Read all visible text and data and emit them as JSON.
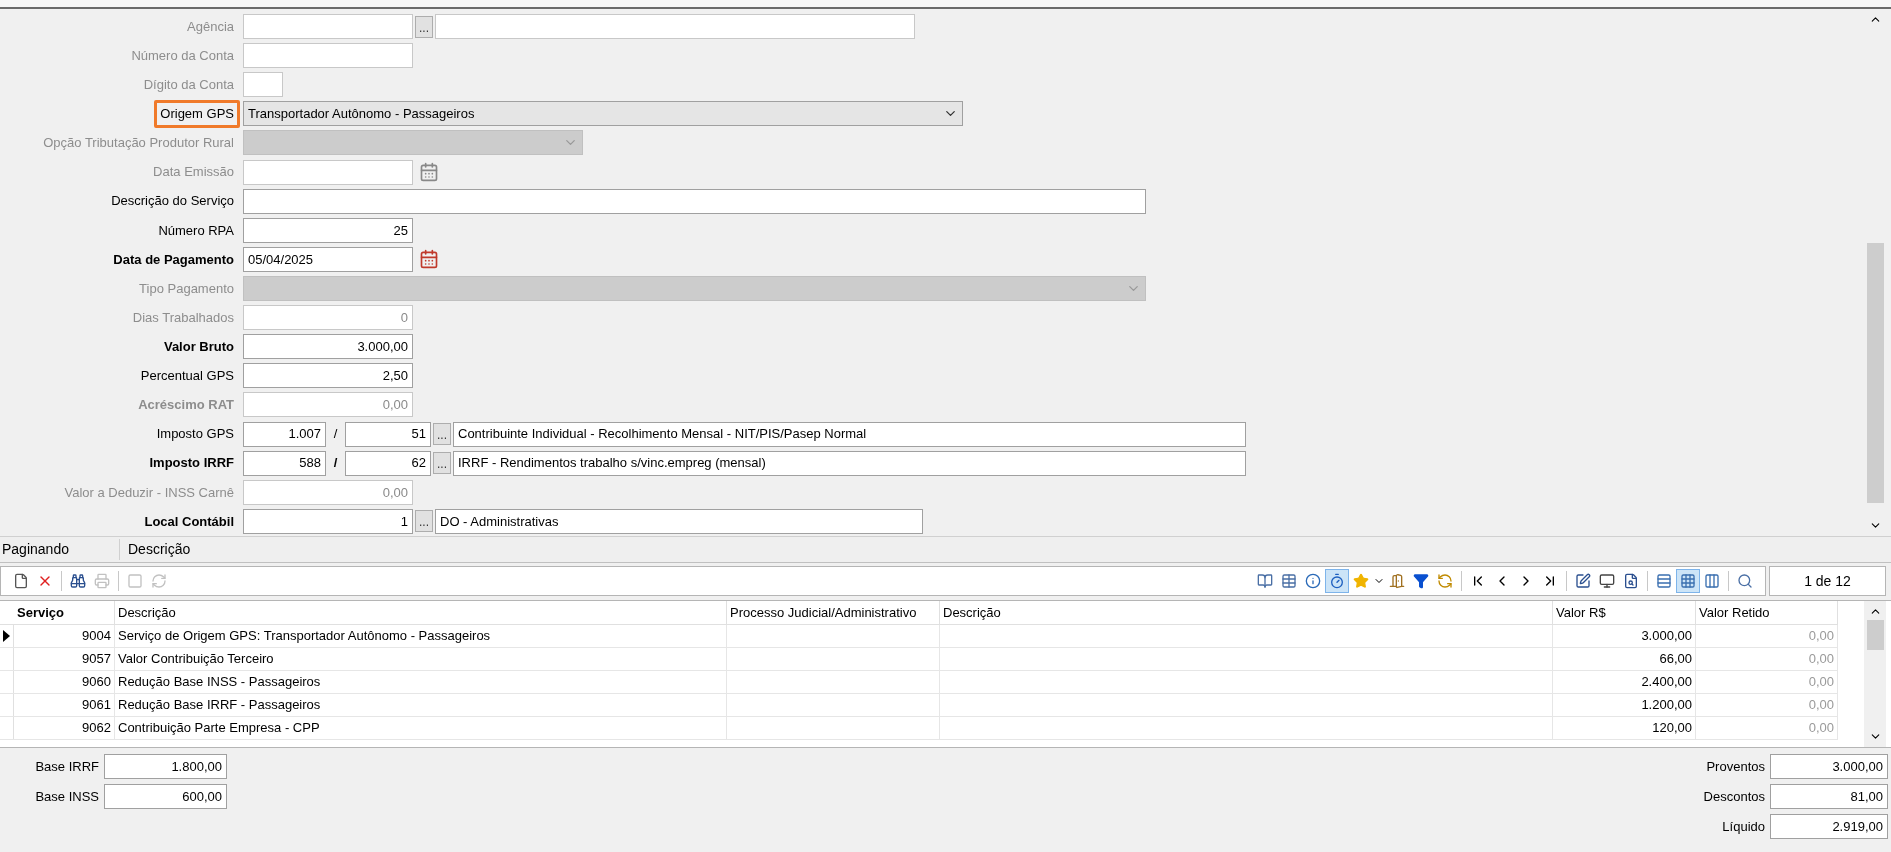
{
  "form": {
    "rows": [
      {
        "label": "Agência",
        "bold": false,
        "disabled": true,
        "highlighted": false,
        "kind": "lookup",
        "button": "..."
      },
      {
        "label": "Número da Conta",
        "bold": false,
        "disabled": true,
        "highlighted": false,
        "kind": "text"
      },
      {
        "label": "Dígito da Conta",
        "bold": false,
        "disabled": true,
        "highlighted": false,
        "kind": "text"
      },
      {
        "label": "Origem GPS",
        "bold": false,
        "disabled": false,
        "highlighted": true,
        "kind": "select",
        "value": "Transportador Autônomo - Passageiros"
      },
      {
        "label": "Opção Tributação Produtor Rural",
        "bold": false,
        "disabled": true,
        "highlighted": false,
        "kind": "select"
      },
      {
        "label": "Data Emissão",
        "bold": false,
        "disabled": true,
        "highlighted": false,
        "kind": "date"
      },
      {
        "label": "Descrição do Serviço",
        "bold": false,
        "disabled": false,
        "highlighted": false,
        "kind": "text"
      },
      {
        "label": "Número RPA",
        "bold": false,
        "disabled": false,
        "highlighted": false,
        "kind": "number",
        "value": "25"
      },
      {
        "label": "Data de Pagamento",
        "bold": true,
        "disabled": false,
        "highlighted": false,
        "kind": "date",
        "value": "05/04/2025"
      },
      {
        "label": "Tipo Pagamento",
        "bold": false,
        "disabled": true,
        "highlighted": false,
        "kind": "select"
      },
      {
        "label": "Dias Trabalhados",
        "bold": false,
        "disabled": true,
        "highlighted": false,
        "kind": "number",
        "value": "0"
      },
      {
        "label": "Valor Bruto",
        "bold": true,
        "disabled": false,
        "highlighted": false,
        "kind": "number",
        "value": "3.000,00"
      },
      {
        "label": "Percentual GPS",
        "bold": false,
        "disabled": false,
        "highlighted": false,
        "kind": "number",
        "value": "2,50"
      },
      {
        "label": "Acréscimo RAT",
        "bold": true,
        "disabled": true,
        "highlighted": false,
        "kind": "number",
        "value": "0,00"
      },
      {
        "label": "Imposto GPS",
        "bold": false,
        "disabled": false,
        "highlighted": false,
        "kind": "pair",
        "values": [
          "1.007",
          "51",
          "Contribuinte Individual - Recolhimento Mensal - NIT/PIS/Pasep Normal"
        ],
        "separator": "/",
        "button": "..."
      },
      {
        "label": "Imposto IRRF",
        "bold": true,
        "disabled": false,
        "highlighted": false,
        "kind": "pair",
        "values": [
          "588",
          "62",
          "IRRF - Rendimentos trabalho s/vinc.empreg (mensal)"
        ],
        "separator": "/",
        "button": "..."
      },
      {
        "label": "Valor a Deduzir - INSS Carnê",
        "bold": false,
        "disabled": true,
        "highlighted": false,
        "kind": "number",
        "value": "0,00"
      },
      {
        "label": "Local Contábil",
        "bold": true,
        "disabled": false,
        "highlighted": false,
        "kind": "code",
        "values": [
          "1",
          "DO - Administrativas"
        ],
        "button": "..."
      }
    ]
  },
  "group_header": [
    "Paginando",
    "Descrição"
  ],
  "toolbar": {
    "buttons": [
      {
        "pressed": false,
        "disabled": false
      },
      {
        "pressed": false,
        "disabled": false
      },
      {
        "pressed": false,
        "disabled": false
      },
      {
        "pressed": false,
        "disabled": true
      },
      {
        "pressed": false,
        "disabled": true
      },
      {
        "pressed": false,
        "disabled": true
      },
      {
        "pressed": false,
        "disabled": false
      },
      {
        "pressed": false,
        "disabled": false
      },
      {
        "pressed": false,
        "disabled": false
      },
      {
        "pressed": true,
        "disabled": false
      },
      {
        "pressed": false,
        "disabled": false
      },
      {
        "pressed": false,
        "disabled": false
      },
      {
        "pressed": false,
        "disabled": false
      },
      {
        "pressed": false,
        "disabled": false
      },
      {
        "pressed": false,
        "disabled": false
      },
      {
        "pressed": false,
        "disabled": false
      },
      {
        "pressed": false,
        "disabled": false
      },
      {
        "pressed": false,
        "disabled": false
      },
      {
        "pressed": false,
        "disabled": false
      },
      {
        "pressed": false,
        "disabled": false
      },
      {
        "pressed": false,
        "disabled": false
      },
      {
        "pressed": false,
        "disabled": false
      },
      {
        "pressed": true,
        "disabled": false
      },
      {
        "pressed": false,
        "disabled": false
      },
      {
        "pressed": false,
        "disabled": false
      }
    ],
    "pager": "1 de 12"
  },
  "table": {
    "columns": [
      "Serviço",
      "Descrição",
      "Processo Judicial/Administrativo",
      "Descrição",
      "Valor R$",
      "Valor Retido"
    ],
    "rows": [
      {
        "selected": true,
        "service": "9004",
        "description": "Serviço de Origem GPS: Transportador Autônomo - Passageiros",
        "value": "3.000,00",
        "retained": "0,00"
      },
      {
        "selected": false,
        "service": "9057",
        "description": "Valor Contribuição Terceiro",
        "value": "66,00",
        "retained": "0,00"
      },
      {
        "selected": false,
        "service": "9060",
        "description": "Redução Base INSS - Passageiros",
        "value": "2.400,00",
        "retained": "0,00"
      },
      {
        "selected": false,
        "service": "9061",
        "description": "Redução Base IRRF - Passageiros",
        "value": "1.200,00",
        "retained": "0,00"
      },
      {
        "selected": false,
        "service": "9062",
        "description": "Contribuição Parte Empresa - CPP",
        "value": "120,00",
        "retained": "0,00"
      }
    ]
  },
  "totals_left": [
    {
      "label": "Base IRRF",
      "value": "1.800,00"
    },
    {
      "label": "Base INSS",
      "value": "600,00"
    }
  ],
  "totals_right": [
    {
      "label": "Proventos",
      "value": "3.000,00"
    },
    {
      "label": "Descontos",
      "value": "81,00"
    },
    {
      "label": "Líquido",
      "value": "2.919,00"
    }
  ]
}
